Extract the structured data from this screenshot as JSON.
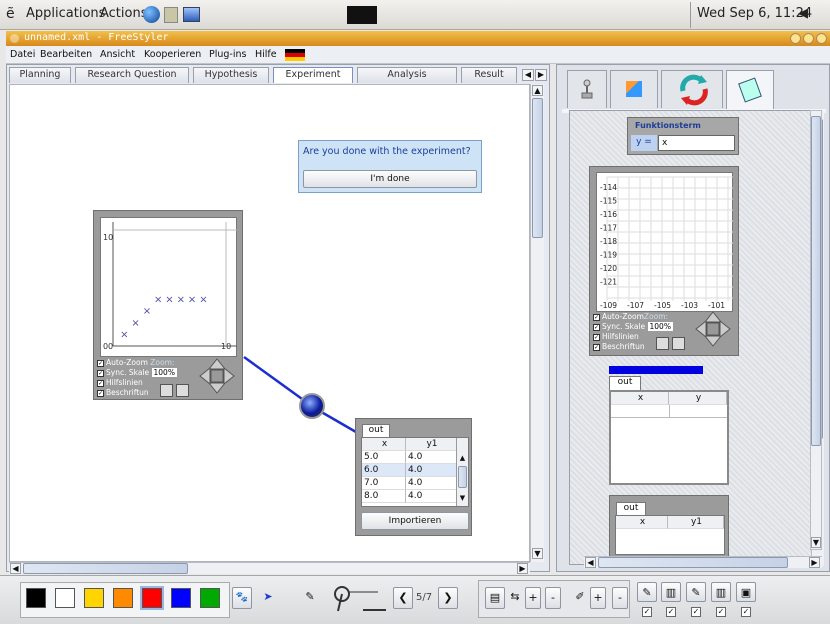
{
  "topbar": {
    "applications": "Applications",
    "actions": "Actions",
    "clock": "Wed Sep  6, 11:24"
  },
  "window": {
    "title": "unnamed.xml - FreeStyler"
  },
  "menu": [
    "Datei",
    "Bearbeiten",
    "Ansicht",
    "Kooperieren",
    "Plug-ins",
    "Hilfe"
  ],
  "tabs": [
    "Planning",
    "Research Question",
    "Hypothesis",
    "Experiment",
    "Analysis",
    "Result"
  ],
  "active_tab": "Experiment",
  "dialog": {
    "question": "Are you done with the experiment?",
    "button": "I'm done"
  },
  "plot_left": {
    "y_max": "10",
    "x_zero": "0",
    "y_zero": "0",
    "x_end": "10",
    "controls": [
      "Auto-Zoom",
      "Sync. Skale",
      "Hilfslinien",
      "Beschriftun"
    ],
    "zoom_label": "Zoom:",
    "zoom_value": "100%"
  },
  "chart_data": {
    "type": "scatter",
    "x": [
      1,
      2,
      3,
      4,
      5,
      6,
      7,
      8
    ],
    "y": [
      1,
      2,
      3,
      4,
      4,
      4,
      4,
      4
    ],
    "xlim": [
      0,
      10
    ],
    "ylim": [
      0,
      10
    ]
  },
  "out_table": {
    "tab": "out",
    "headers": [
      "x",
      "y1"
    ],
    "rows": [
      [
        "5.0",
        "4.0"
      ],
      [
        "6.0",
        "4.0"
      ],
      [
        "7.0",
        "4.0"
      ],
      [
        "8.0",
        "4.0"
      ]
    ],
    "button": "Importieren"
  },
  "function_box": {
    "title": "Funktionsterm",
    "label": "y =",
    "value": "x"
  },
  "plot_right": {
    "y_ticks": [
      "-114",
      "-115",
      "-116",
      "-117",
      "-118",
      "-119",
      "-120",
      "-121"
    ],
    "x_ticks": [
      "-109",
      "-107",
      "-105",
      "-103",
      "-101"
    ],
    "controls": [
      "Auto-Zoom",
      "Sync. Skale",
      "Hilfslinien",
      "Beschriftun"
    ],
    "zoom_label": "Zoom:",
    "zoom_value": "100%"
  },
  "out_table2": {
    "tab": "out",
    "headers": [
      "x",
      "y"
    ]
  },
  "out_table3": {
    "tab": "out",
    "headers": [
      "x",
      "y1"
    ]
  },
  "pager": {
    "label": "5/7"
  },
  "colors": {
    "accent": "#0000cc",
    "swatches": [
      "#000000",
      "#ffffff",
      "#ffd400",
      "#ff8a00",
      "#ff0000",
      "#0000ff",
      "#00aa00"
    ]
  }
}
